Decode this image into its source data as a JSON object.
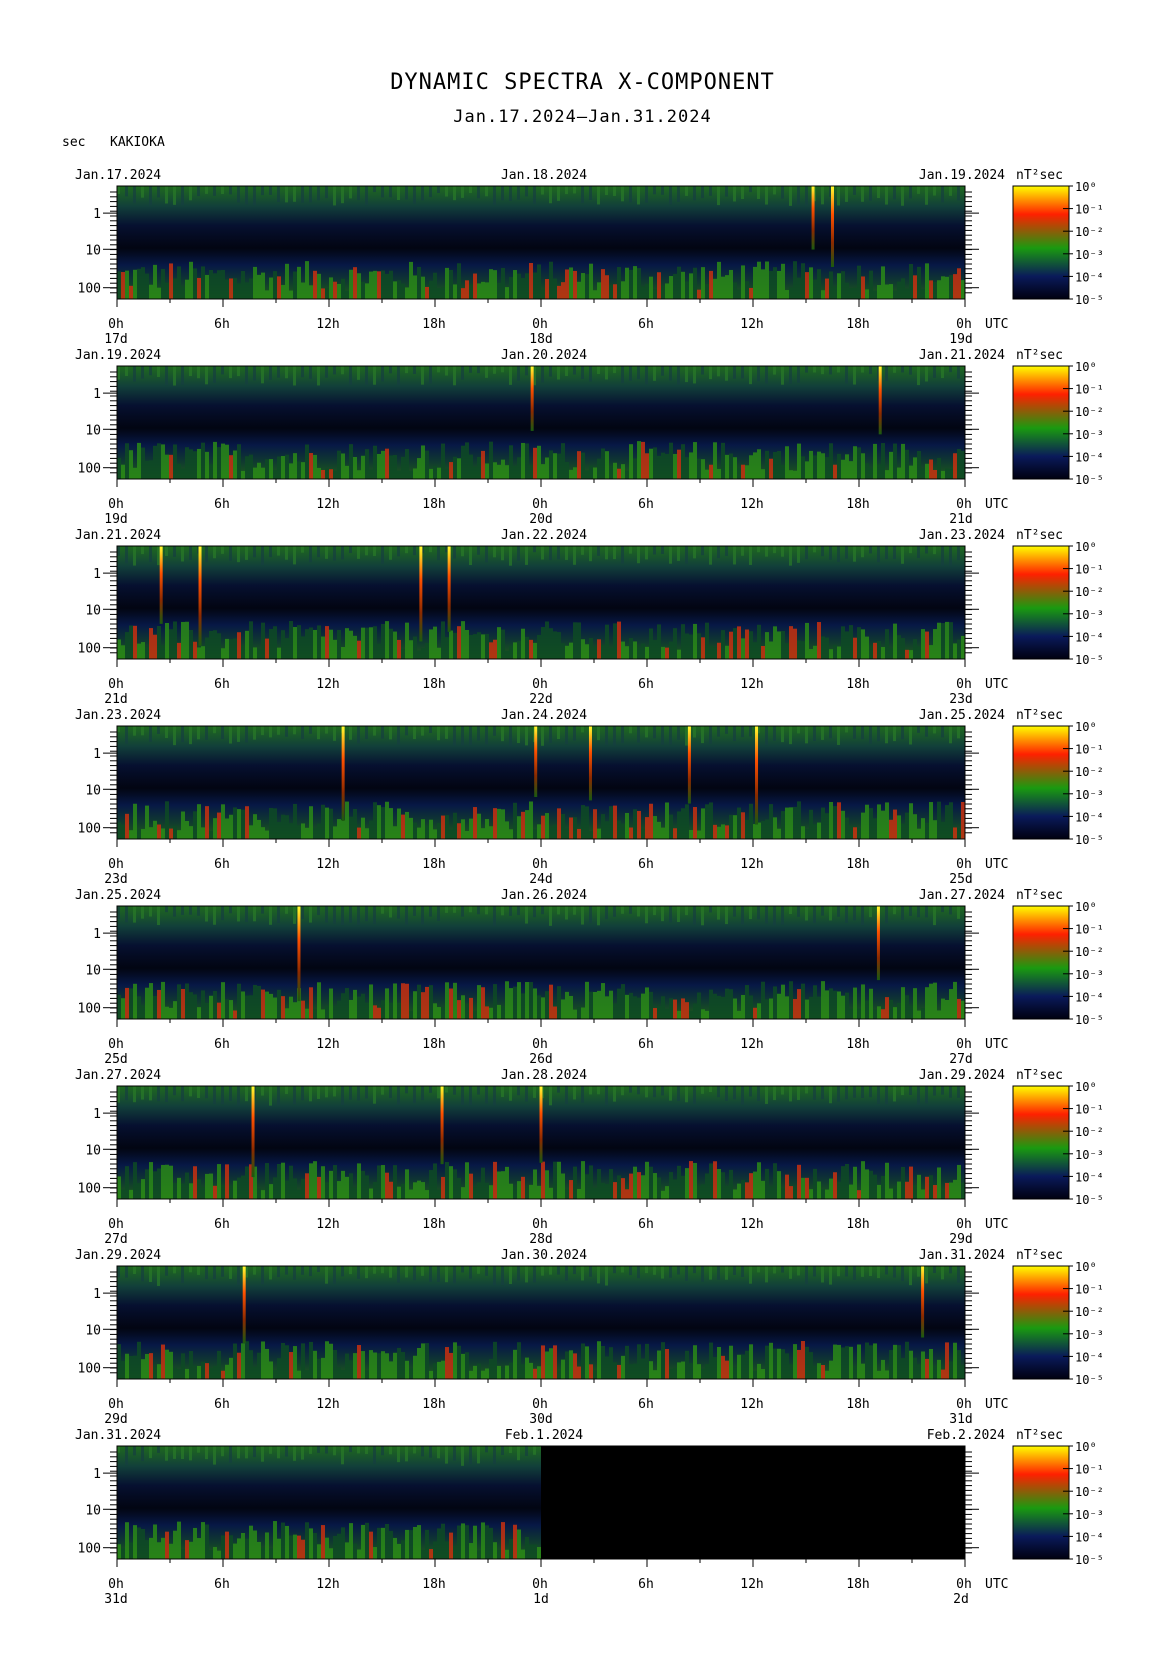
{
  "title": "DYNAMIC SPECTRA X-COMPONENT",
  "subtitle": "Jan.17.2024–Jan.31.2024",
  "y_unit": "sec",
  "station": "KAKIOKA",
  "colorbar_unit": "nT²sec",
  "colorbar_ticks": [
    "10⁰",
    "10⁻¹",
    "10⁻²",
    "10⁻³",
    "10⁻⁴",
    "10⁻⁵"
  ],
  "x_unit": "UTC",
  "colors": {
    "high": "#ffff00",
    "mid_high": "#ff2000",
    "mid": "#1a9a10",
    "low": "#0a1a5a",
    "none": "#000000"
  },
  "chart_data": {
    "type": "heatmap",
    "y_axis": {
      "label": "sec",
      "scale": "log",
      "ticks": [
        "1",
        "10",
        "100"
      ]
    },
    "x_ticks": [
      "0h",
      "6h",
      "12h",
      "18h",
      "0h",
      "6h",
      "12h",
      "18h",
      "0h"
    ],
    "colorbar": {
      "label": "nT²sec",
      "scale": "log",
      "range": [
        1e-05,
        1
      ]
    },
    "panels": [
      {
        "date_left": "Jan.17.2024",
        "date_mid": "Jan.18.2024",
        "date_right": "Jan.19.2024",
        "day_left": "17d",
        "day_mid": "18d",
        "day_right": "19d",
        "spikes_hours": [
          39.4,
          40.5
        ]
      },
      {
        "date_left": "Jan.19.2024",
        "date_mid": "Jan.20.2024",
        "date_right": "Jan.21.2024",
        "day_left": "19d",
        "day_mid": "20d",
        "day_right": "21d",
        "spikes_hours": [
          23.5,
          43.2
        ]
      },
      {
        "date_left": "Jan.21.2024",
        "date_mid": "Jan.22.2024",
        "date_right": "Jan.23.2024",
        "day_left": "21d",
        "day_mid": "22d",
        "day_right": "23d",
        "spikes_hours": [
          2.5,
          4.7,
          17.2,
          18.8
        ]
      },
      {
        "date_left": "Jan.23.2024",
        "date_mid": "Jan.24.2024",
        "date_right": "Jan.25.2024",
        "day_left": "23d",
        "day_mid": "24d",
        "day_right": "25d",
        "spikes_hours": [
          12.8,
          23.7,
          26.8,
          32.4,
          36.2
        ]
      },
      {
        "date_left": "Jan.25.2024",
        "date_mid": "Jan.26.2024",
        "date_right": "Jan.27.2024",
        "day_left": "25d",
        "day_mid": "26d",
        "day_right": "27d",
        "spikes_hours": [
          10.3,
          43.1
        ]
      },
      {
        "date_left": "Jan.27.2024",
        "date_mid": "Jan.28.2024",
        "date_right": "Jan.29.2024",
        "day_left": "27d",
        "day_mid": "28d",
        "day_right": "29d",
        "spikes_hours": [
          7.7,
          18.4,
          24.0
        ]
      },
      {
        "date_left": "Jan.29.2024",
        "date_mid": "Jan.30.2024",
        "date_right": "Jan.31.2024",
        "day_left": "29d",
        "day_mid": "30d",
        "day_right": "31d",
        "spikes_hours": [
          7.2,
          45.6
        ]
      },
      {
        "date_left": "Jan.31.2024",
        "date_mid": "Feb.1.2024",
        "date_right": "Feb.2.2024",
        "day_left": "31d",
        "day_mid": "1d",
        "day_right": "2d",
        "spikes_hours": [],
        "data_end_hour": 24
      }
    ]
  }
}
